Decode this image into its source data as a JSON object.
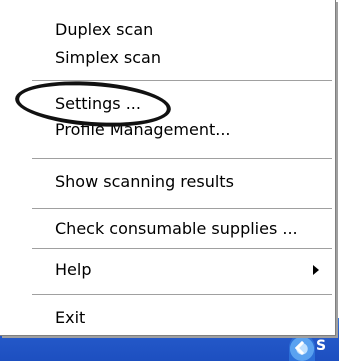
{
  "menu": {
    "items": [
      {
        "label": "Duplex scan"
      },
      {
        "label": "Simplex scan"
      },
      {
        "label": "Settings ..."
      },
      {
        "label": "Profile Management..."
      },
      {
        "label": "Show scanning results"
      },
      {
        "label": "Check consumable supplies ..."
      },
      {
        "label": "Help"
      },
      {
        "label": "Exit"
      }
    ]
  },
  "taskbar": {
    "tray_text": "S"
  },
  "icons": [
    "submenu-arrow-icon",
    "tray-scanner-icon"
  ],
  "colors": {
    "menu_background": "#ffffff",
    "taskbar_blue": "#2459c9",
    "highlight_ellipse": "#111111"
  }
}
